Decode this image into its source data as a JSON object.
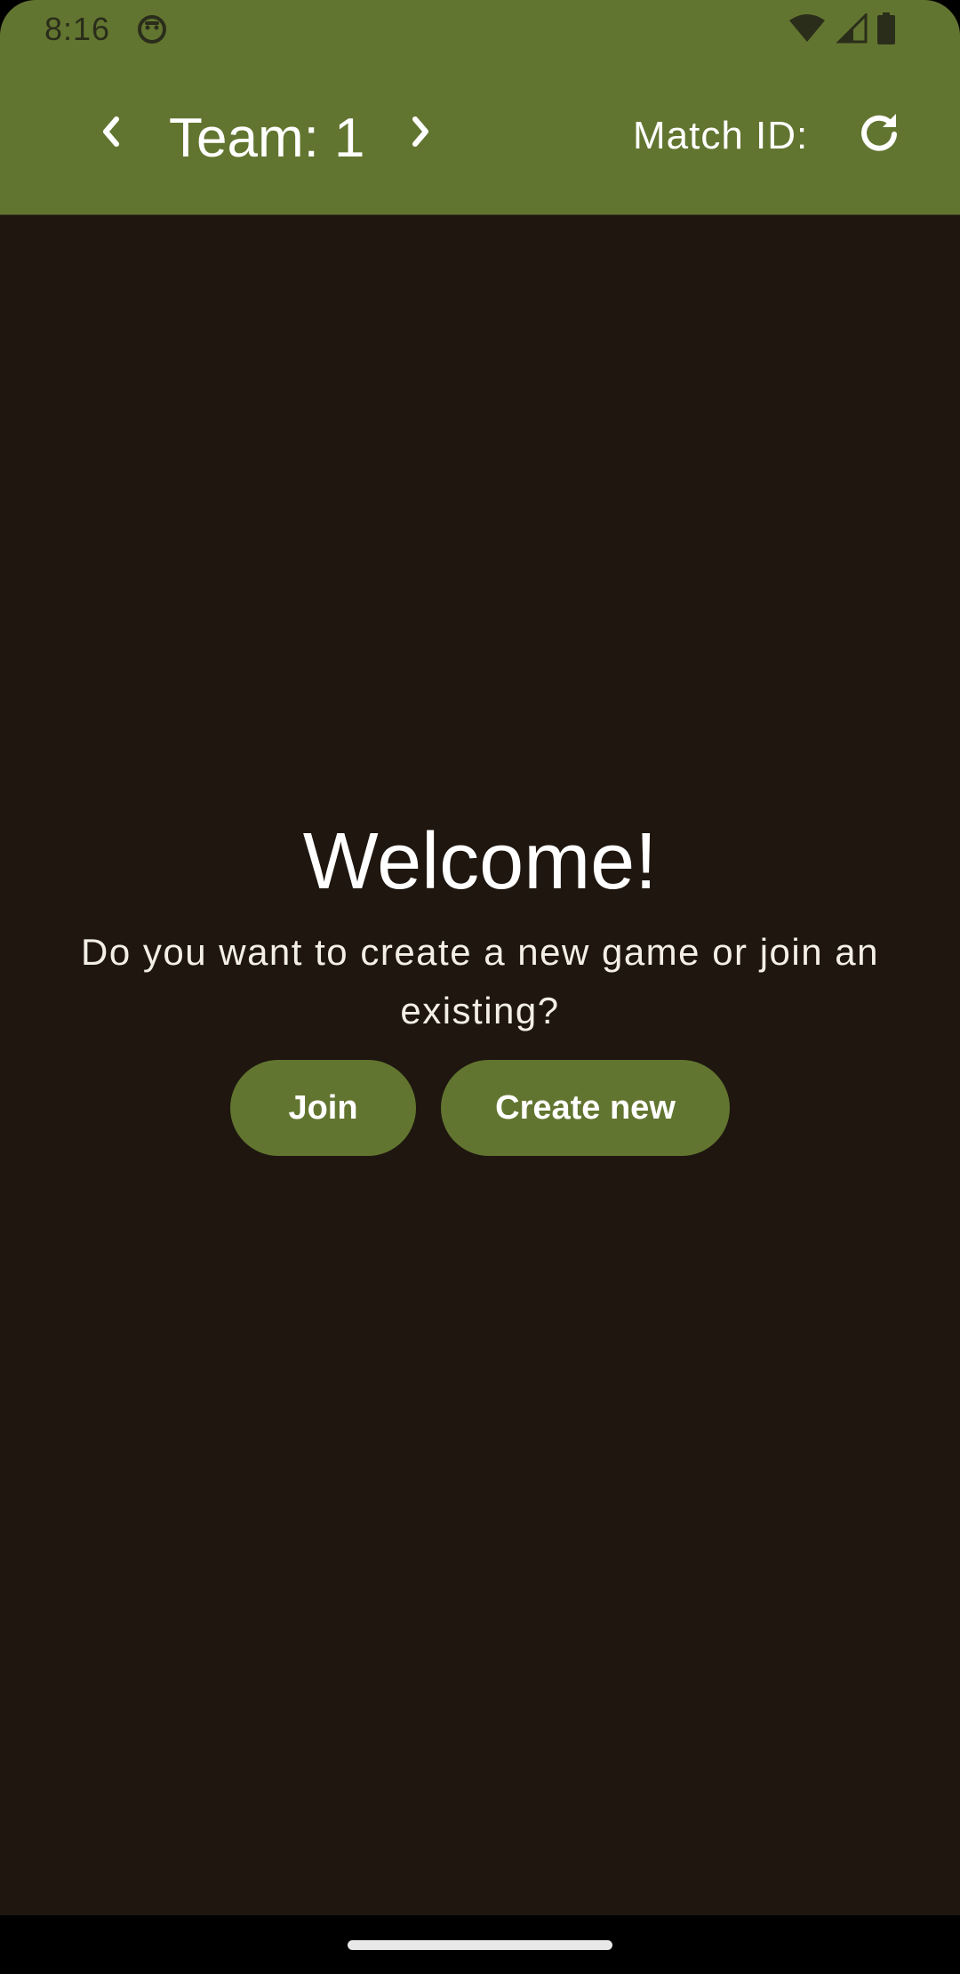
{
  "status_bar": {
    "time": "8:16",
    "icons": [
      "app-notification-icon",
      "wifi-icon",
      "signal-icon",
      "battery-icon"
    ]
  },
  "app_bar": {
    "team_label": "Team: 1",
    "match_id_label": "Match ID:",
    "icons": [
      "chevron-left-icon",
      "chevron-right-icon",
      "refresh-icon"
    ]
  },
  "welcome": {
    "title": "Welcome!",
    "subtitle": "Do you want to create a new game or join an existing?"
  },
  "actions": {
    "join_label": "Join",
    "create_label": "Create new"
  },
  "colors": {
    "primary": "#627530",
    "background": "#1e160f",
    "on_primary": "#ffffff"
  }
}
